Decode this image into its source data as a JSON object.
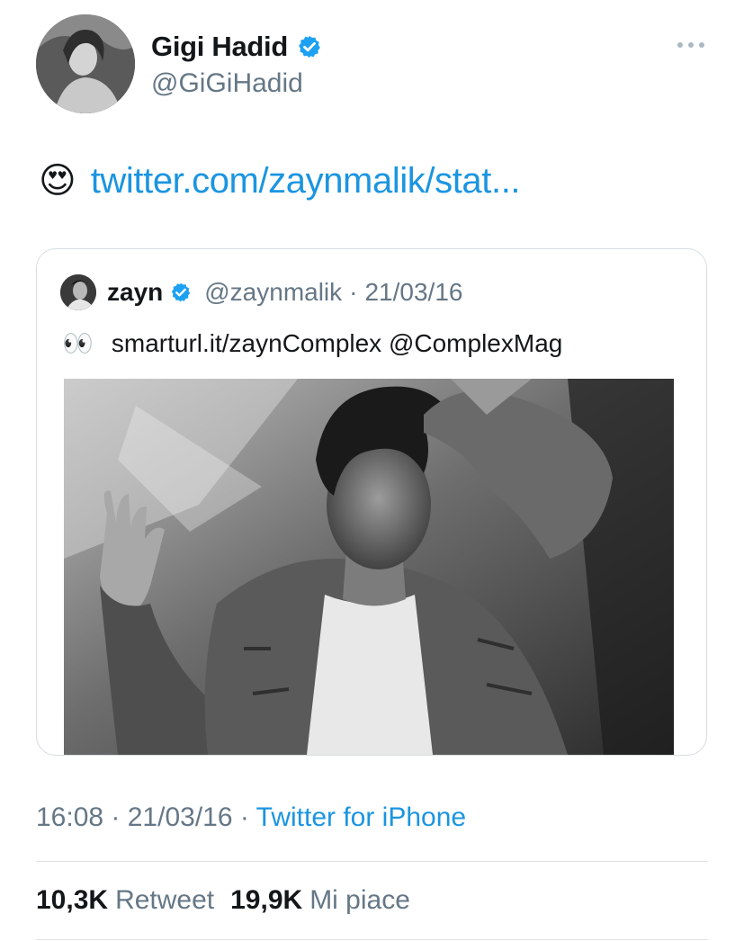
{
  "author": {
    "display_name": "Gigi Hadid",
    "handle": "@GiGiHadid",
    "verified": true
  },
  "tweet": {
    "emoji": "😍",
    "link_text": "twitter.com/zaynmalik/stat..."
  },
  "quoted": {
    "name": "zayn",
    "handle": "@zaynmalik",
    "separator": "·",
    "date": "21/03/16",
    "emoji": "👀",
    "text": "smarturl.it/zaynComplex @ComplexMag"
  },
  "meta": {
    "time": "16:08",
    "sep1": " · ",
    "date": "21/03/16",
    "sep2": " · ",
    "source": "Twitter for iPhone"
  },
  "stats": {
    "retweets_count": "10,3K",
    "retweets_label": "Retweet",
    "likes_count": "19,9K",
    "likes_label": "Mi piace"
  },
  "colors": {
    "link": "#1b95e0",
    "secondary_text": "#657786",
    "verified_badge": "#1da1f2",
    "border": "#d7dde1"
  },
  "icons": {
    "more": "more-horizontal-icon",
    "verified": "verified-badge-icon"
  }
}
